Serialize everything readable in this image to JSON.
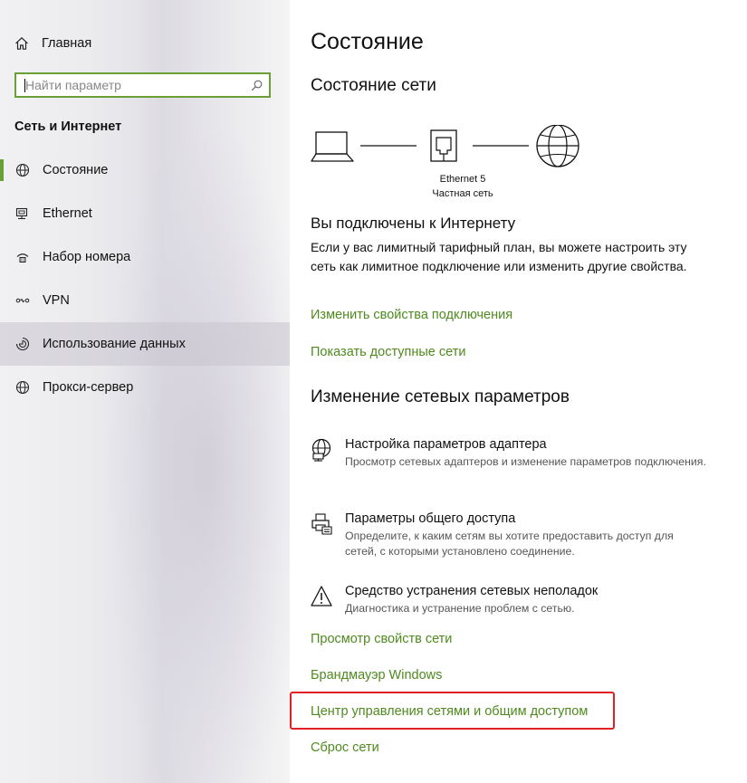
{
  "sidebar": {
    "home_label": "Главная",
    "search": {
      "placeholder": "Найти параметр"
    },
    "section_title": "Сеть и Интернет",
    "items": [
      {
        "label": "Состояние",
        "icon": "globe-icon",
        "selected": true
      },
      {
        "label": "Ethernet",
        "icon": "ethernet-icon"
      },
      {
        "label": "Набор номера",
        "icon": "dialup-icon"
      },
      {
        "label": "VPN",
        "icon": "vpn-icon"
      },
      {
        "label": "Использование данных",
        "icon": "data-usage-icon",
        "hovered": true
      },
      {
        "label": "Прокси-сервер",
        "icon": "globe-icon"
      }
    ]
  },
  "main": {
    "title": "Состояние",
    "network_status_title": "Состояние сети",
    "diagram": {
      "adapter_name": "Ethernet 5",
      "network_type": "Частная сеть"
    },
    "connected_heading": "Вы подключены к Интернету",
    "connected_desc": "Если у вас лимитный тарифный план, вы можете настроить эту сеть как лимитное подключение или изменить другие свойства.",
    "links_top": [
      "Изменить свойства подключения",
      "Показать доступные сети"
    ],
    "change_section_title": "Изменение сетевых параметров",
    "options": [
      {
        "title": "Настройка параметров адаптера",
        "desc": "Просмотр сетевых адаптеров и изменение параметров подключения.",
        "icon": "adapter-globe-icon"
      },
      {
        "title": "Параметры общего доступа",
        "desc": "Определите, к каким сетям вы хотите предоставить доступ для сетей, с которыми установлено соединение.",
        "icon": "sharing-printer-icon"
      },
      {
        "title": "Средство устранения сетевых неполадок",
        "desc": "Диагностика и устранение проблем с сетью.",
        "icon": "warning-icon"
      }
    ],
    "links_bottom": [
      "Просмотр свойств сети",
      "Брандмауэр Windows",
      "Центр управления сетями и общим доступом",
      "Сброс сети"
    ]
  },
  "colors": {
    "accent": "#4e8a1e",
    "selection_bar": "#6a9f35",
    "highlight": "#e31e24"
  }
}
